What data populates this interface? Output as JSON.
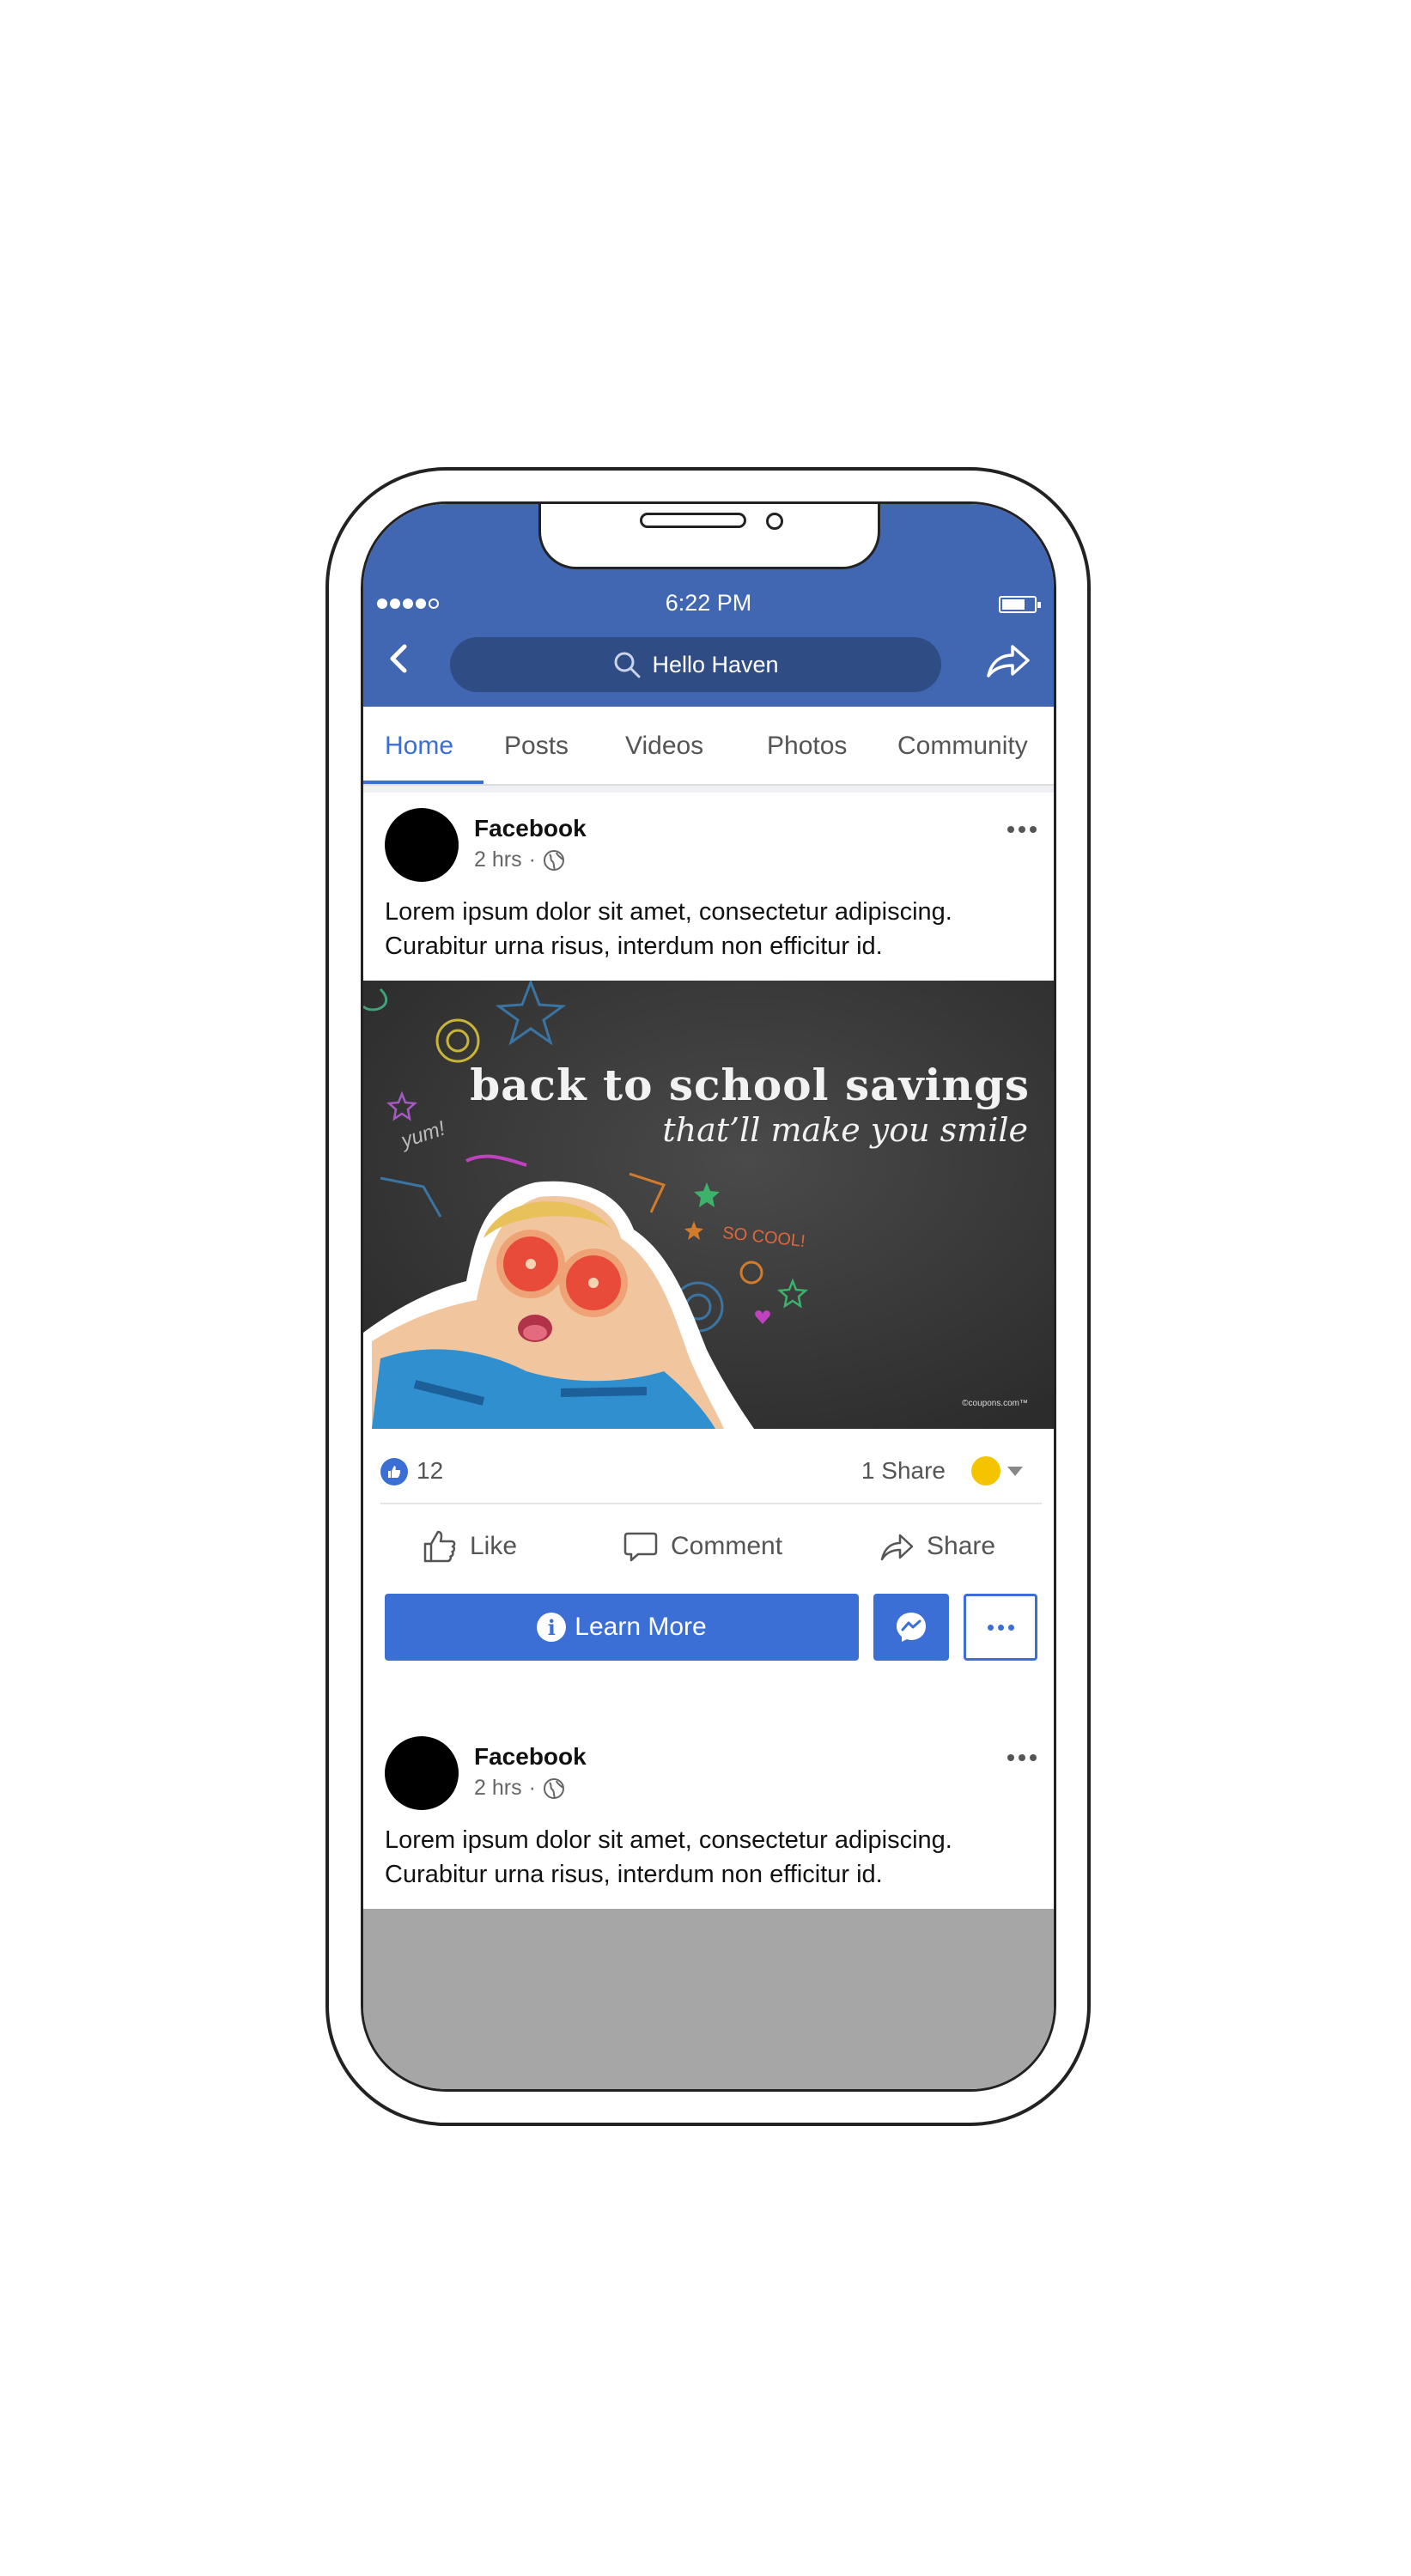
{
  "status": {
    "time": "6:22 PM"
  },
  "navbar": {
    "search_text": "Hello Haven"
  },
  "tabs": [
    {
      "label": "Home"
    },
    {
      "label": "Posts"
    },
    {
      "label": "Videos"
    },
    {
      "label": "Photos"
    },
    {
      "label": "Community"
    }
  ],
  "posts": [
    {
      "author": "Facebook",
      "time": "2 hrs",
      "text_line1": "Lorem ipsum dolor sit amet, consectetur adipiscing.",
      "text_line2": "Curabitur urna risus, interdum non efficitur id."
    },
    {
      "author": "Facebook",
      "time": "2 hrs",
      "text_line1": "Lorem ipsum dolor sit amet, consectetur adipiscing.",
      "text_line2": "Curabitur urna risus, interdum non efficitur id."
    }
  ],
  "ad": {
    "headline": "back to school savings",
    "subheadline": "that’ll make you smile",
    "chalk_yum": "yum!",
    "chalk_cool": "SO COOL!",
    "credit": "©coupons.com™"
  },
  "reactions": {
    "likes": "12",
    "shares": "1 Share"
  },
  "actions": {
    "like": "Like",
    "comment": "Comment",
    "share": "Share"
  },
  "cta": {
    "learn_more": "Learn More"
  },
  "colors": {
    "brand_blue": "#4267b2",
    "accent_blue": "#3b6fd6",
    "reaction_yellow": "#f5c400"
  },
  "icons": [
    "back-icon",
    "search-icon",
    "share-arrow-icon",
    "globe-icon",
    "more-dots-icon",
    "thumbs-up-icon",
    "comment-icon",
    "share-icon",
    "info-icon",
    "messenger-icon"
  ]
}
